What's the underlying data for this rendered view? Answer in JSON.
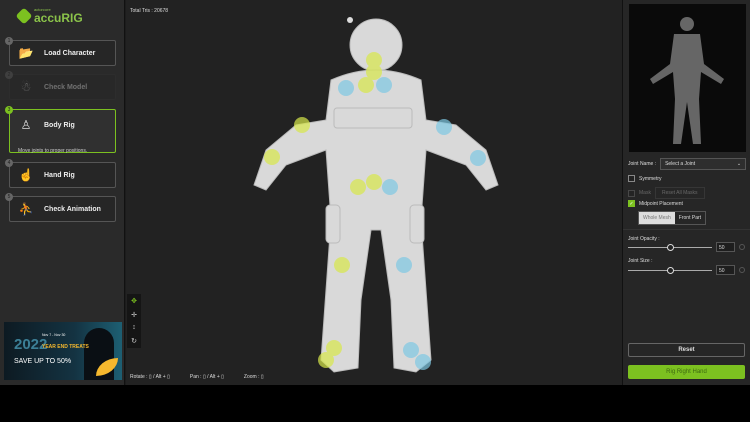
{
  "app": {
    "logo_small": "actorcore",
    "logo_big": "accuRIG"
  },
  "steps": [
    {
      "num": "1",
      "label": "Load Character",
      "icon": "load-icon"
    },
    {
      "num": "2",
      "label": "Check Model",
      "icon": "model-icon"
    },
    {
      "num": "3",
      "label": "Body Rig",
      "icon": "body-icon",
      "desc": "Move joints to proper positions."
    },
    {
      "num": "4",
      "label": "Hand Rig",
      "icon": "hand-icon"
    },
    {
      "num": "5",
      "label": "Check Animation",
      "icon": "animation-icon"
    }
  ],
  "banner": {
    "year": "2022",
    "dates": "Nov 7 - Nov 30",
    "title": "YEAR END TREATS",
    "save": "SAVE UP TO 50%"
  },
  "viewport": {
    "tris": "Total Tris : 20678",
    "rotate": "Rotate :",
    "pan": "Pan :",
    "zoom": "Zoom :",
    "alt": "/ Alt +"
  },
  "right": {
    "joint_name_label": "Joint Name :",
    "joint_select": "Select a Joint",
    "symmetry": "Symmetry",
    "mask": "Mask",
    "reset_masks": "Reset All Masks",
    "midpoint": "Midpoint Placement",
    "whole_mesh": "Whole Mesh",
    "front_part": "Front Part",
    "opacity_label": "Joint Opacity :",
    "opacity_value": "50",
    "size_label": "Joint Size :",
    "size_value": "50",
    "reset": "Reset",
    "rig_button": "Rig Right Hand"
  },
  "colors": {
    "accent": "#7cc120",
    "joint_yellow": "#d8e84a",
    "joint_blue": "#7ec8e3"
  }
}
